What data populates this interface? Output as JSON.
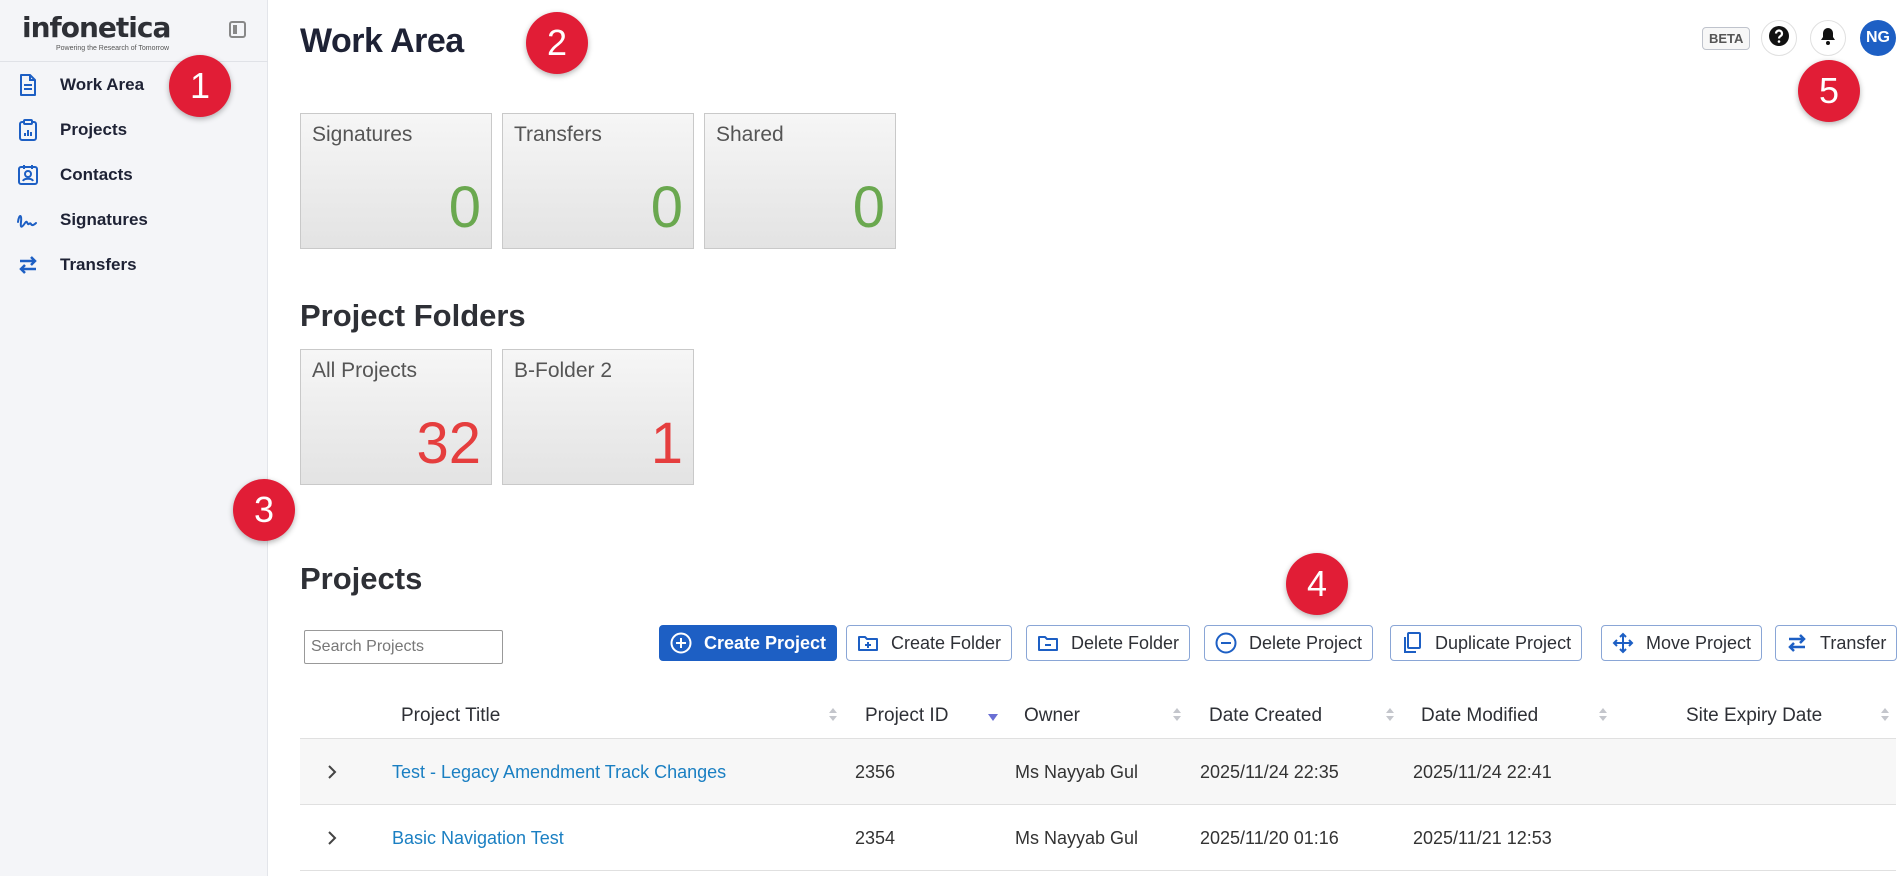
{
  "app": {
    "logo_text": "infonetica",
    "logo_tagline": "Powering the Research of Tomorrow"
  },
  "sidebar": {
    "items": [
      {
        "label": "Work Area",
        "icon": "document-icon"
      },
      {
        "label": "Projects",
        "icon": "clipboard-chart-icon"
      },
      {
        "label": "Contacts",
        "icon": "contact-card-icon"
      },
      {
        "label": "Signatures",
        "icon": "signature-icon"
      },
      {
        "label": "Transfers",
        "icon": "transfer-arrows-icon"
      }
    ]
  },
  "header": {
    "title": "Work Area",
    "beta": "BETA",
    "avatar_initials": "NG"
  },
  "markers": [
    "1",
    "2",
    "3",
    "4",
    "5"
  ],
  "summary_cards": [
    {
      "label": "Signatures",
      "count": "0"
    },
    {
      "label": "Transfers",
      "count": "0"
    },
    {
      "label": "Shared",
      "count": "0"
    }
  ],
  "folders": {
    "title": "Project Folders",
    "items": [
      {
        "label": "All Projects",
        "count": "32"
      },
      {
        "label": "B-Folder 2",
        "count": "1"
      }
    ]
  },
  "projects": {
    "title": "Projects",
    "search_placeholder": "Search Projects",
    "toolbar": {
      "create_project": "Create Project",
      "create_folder": "Create Folder",
      "delete_folder": "Delete Folder",
      "delete_project": "Delete Project",
      "duplicate_project": "Duplicate Project",
      "move_project": "Move Project",
      "transfer": "Transfer"
    },
    "columns": [
      "Project Title",
      "Project ID",
      "Owner",
      "Date Created",
      "Date Modified",
      "Site Expiry Date"
    ],
    "rows": [
      {
        "title": "Test - Legacy Amendment Track Changes",
        "id": "2356",
        "owner": "Ms Nayyab Gul",
        "created": "2025/11/24 22:35",
        "modified": "2025/11/24 22:41",
        "expiry": ""
      },
      {
        "title": "Basic Navigation Test",
        "id": "2354",
        "owner": "Ms Nayyab Gul",
        "created": "2025/11/20 01:16",
        "modified": "2025/11/21 12:53",
        "expiry": ""
      }
    ]
  },
  "colors": {
    "brand_blue": "#1d5fc4",
    "marker_red": "#e11d36",
    "count_green": "#6aa84f",
    "count_red": "#e53e3e",
    "link_blue": "#1a7fc2"
  }
}
